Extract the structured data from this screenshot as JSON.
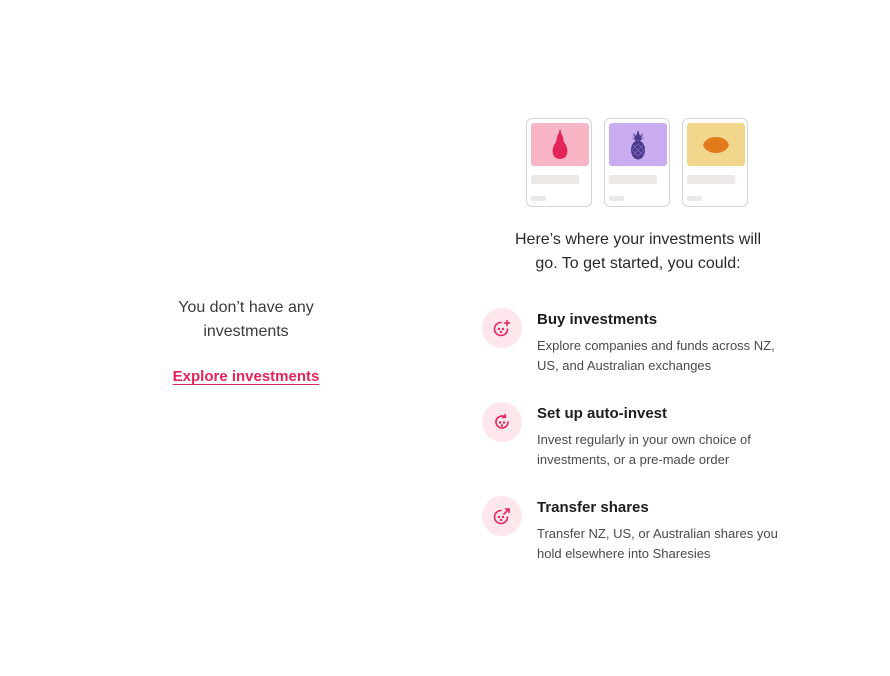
{
  "empty_state": {
    "message": "You don’t have any investments",
    "explore_link": "Explore investments"
  },
  "illustration": {
    "cards": [
      {
        "icon": "pear-icon",
        "thumb_color": "#f8b5c6",
        "fruit_color": "#e5245a"
      },
      {
        "icon": "pineapple-icon",
        "thumb_color": "#c9adf0",
        "fruit_color": "#4b3a87"
      },
      {
        "icon": "lemon-icon",
        "thumb_color": "#f2d68c",
        "fruit_color": "#e07a1a"
      }
    ]
  },
  "intro_text": "Here’s where your investments will go. To get started, you could:",
  "options": [
    {
      "title": "Buy investments",
      "description": "Explore companies and funds across NZ, US, and Australian exchanges",
      "icon": "buy-plus-icon"
    },
    {
      "title": "Set up auto-invest",
      "description": "Invest regularly in your own choice of investments, or a pre-made order",
      "icon": "auto-invest-icon"
    },
    {
      "title": "Transfer shares",
      "description": "Transfer NZ, US, or Australian shares you hold elsewhere into Sharesies",
      "icon": "transfer-icon"
    }
  ],
  "colors": {
    "accent": "#e5245a",
    "icon_bg": "#fde6ec"
  }
}
